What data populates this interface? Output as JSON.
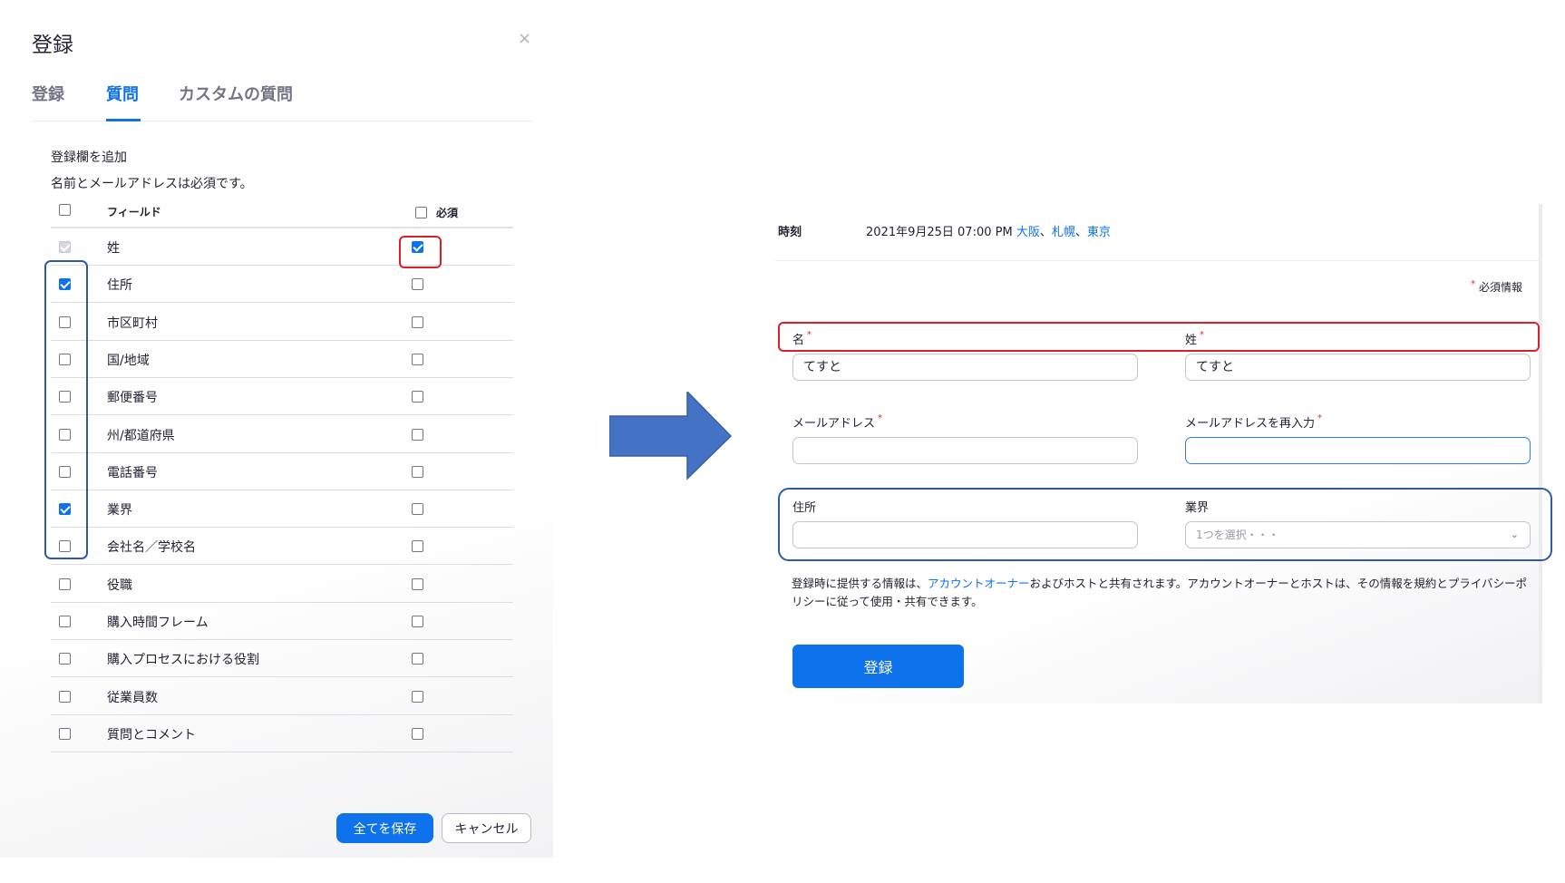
{
  "dialog": {
    "title": "登録",
    "close": "×",
    "tabs": [
      "登録",
      "質問",
      "カスタムの質問"
    ],
    "active_tab": 1,
    "hint_title": "登録欄を追加",
    "hint_body": "名前とメールアドレスは必須です。",
    "header": {
      "field": "フィールド",
      "required": "必須"
    },
    "fields": [
      {
        "label": "姓",
        "included": true,
        "include_disabled": true,
        "required": true
      },
      {
        "label": "住所",
        "included": true,
        "required": false
      },
      {
        "label": "市区町村",
        "included": false,
        "required": false
      },
      {
        "label": "国/地域",
        "included": false,
        "required": false
      },
      {
        "label": "郵便番号",
        "included": false,
        "required": false
      },
      {
        "label": "州/都道府県",
        "included": false,
        "required": false
      },
      {
        "label": "電話番号",
        "included": false,
        "required": false
      },
      {
        "label": "業界",
        "included": true,
        "required": false
      },
      {
        "label": "会社名／学校名",
        "included": false,
        "required": false
      },
      {
        "label": "役職",
        "included": false,
        "required": false
      },
      {
        "label": "購入時間フレーム",
        "included": false,
        "required": false
      },
      {
        "label": "購入プロセスにおける役割",
        "included": false,
        "required": false
      },
      {
        "label": "従業員数",
        "included": false,
        "required": false
      },
      {
        "label": "質問とコメント",
        "included": false,
        "required": false
      }
    ],
    "buttons": {
      "save": "全てを保存",
      "cancel": "キャンセル"
    }
  },
  "arrow": {
    "color": "#4472c4",
    "direction": "right"
  },
  "form": {
    "time_label": "時刻",
    "time_value": "2021年9月25日 07:00 PM",
    "timezones": [
      "大阪",
      "札幌",
      "東京"
    ],
    "timezone_separator": "、",
    "required_mark": "*",
    "required_note": "必須情報",
    "first_name": {
      "label": "名",
      "value": "てすと"
    },
    "last_name": {
      "label": "姓",
      "value": "てすと"
    },
    "email": {
      "label": "メールアドレス",
      "value": ""
    },
    "email_confirm": {
      "label": "メールアドレスを再入力",
      "value": ""
    },
    "address": {
      "label": "住所",
      "value": ""
    },
    "industry": {
      "label": "業界",
      "placeholder": "1つを選択・・・"
    },
    "privacy": {
      "before": "登録時に提供する情報は、",
      "link": "アカウントオーナー",
      "after": "およびホストと共有されます。アカウントオーナーとホストは、その情報を規約とプライバシーポリシーに従って使用・共有できます。"
    },
    "register_button": "登録"
  },
  "colors": {
    "accent": "#0e72ed",
    "highlight_red": "#d7212a",
    "highlight_blue": "#2f5aa8"
  }
}
